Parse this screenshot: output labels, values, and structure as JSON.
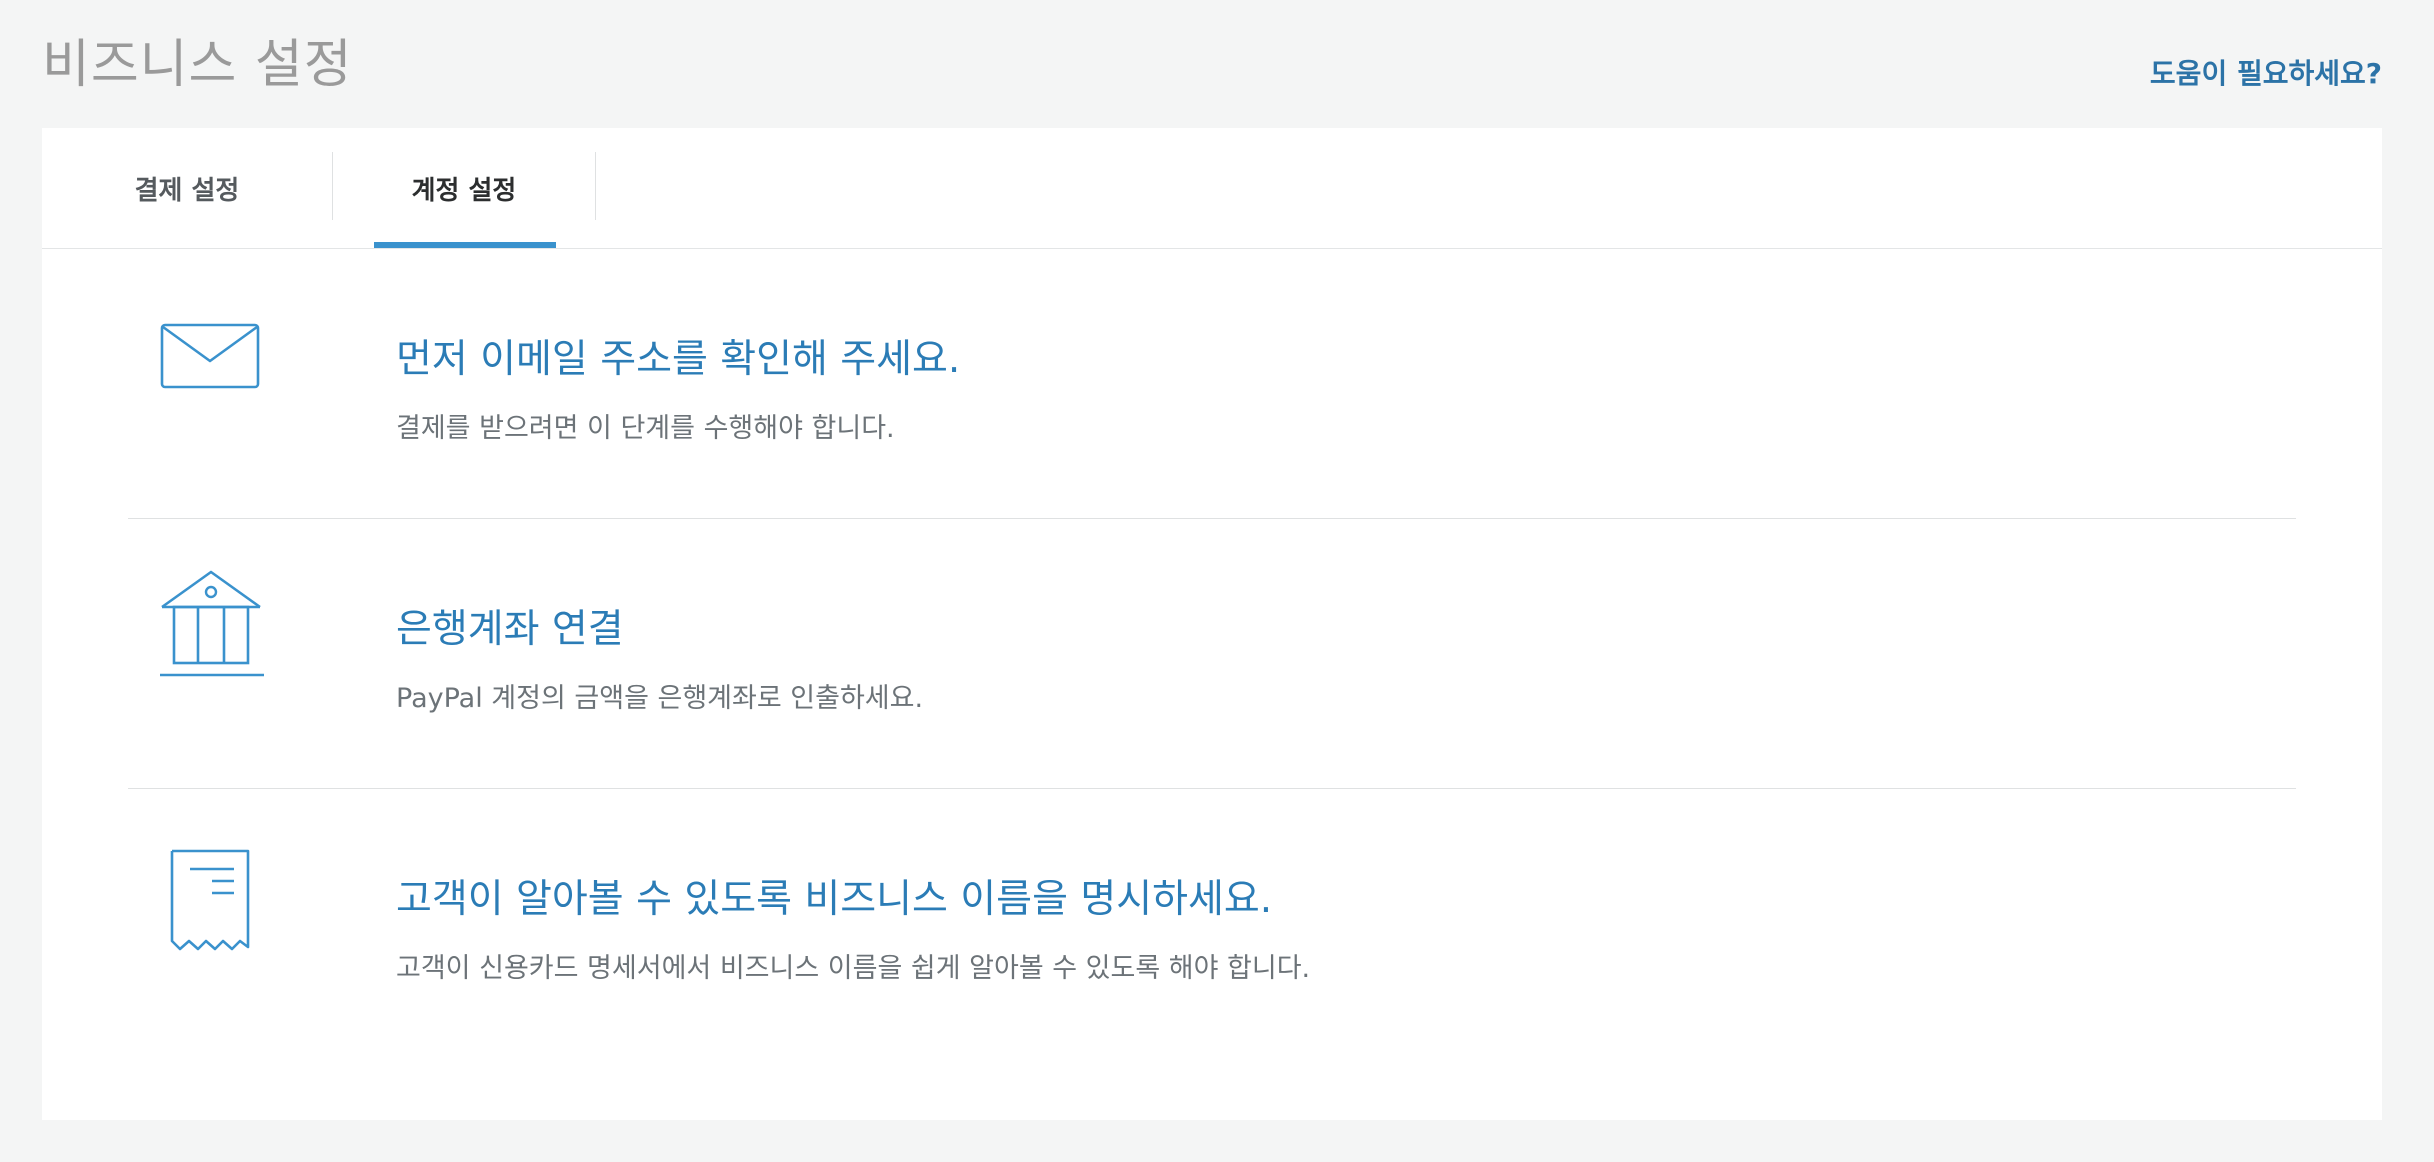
{
  "header": {
    "title": "비즈니스 설정",
    "help_link": "도움이 필요하세요?"
  },
  "tabs": [
    {
      "label": "결제 설정",
      "active": false
    },
    {
      "label": "계정 설정",
      "active": true
    }
  ],
  "tasks": [
    {
      "icon": "envelope-icon",
      "heading": "먼저 이메일 주소를 확인해 주세요.",
      "description": "결제를 받으려면 이 단계를 수행해야 합니다."
    },
    {
      "icon": "bank-icon",
      "heading": "은행계좌 연결",
      "description": "PayPal 계정의 금액을 은행계좌로 인출하세요."
    },
    {
      "icon": "receipt-icon",
      "heading": "고객이 알아볼 수 있도록 비즈니스 이름을 명시하세요.",
      "description": "고객이 신용카드 명세서에서 비즈니스 이름을 쉽게 알아볼 수 있도록 해야 합니다."
    }
  ],
  "colors": {
    "accent": "#2b7cb6",
    "tab_indicator": "#3a92cd",
    "background": "#f4f5f5"
  }
}
